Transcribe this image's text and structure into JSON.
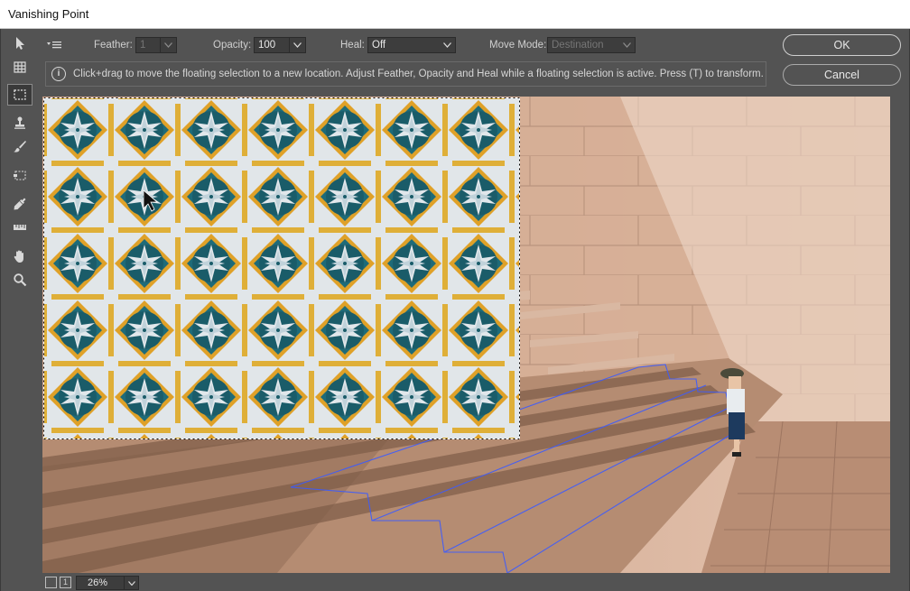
{
  "window": {
    "title": "Vanishing Point"
  },
  "toolbox": {
    "tools": [
      {
        "name": "edit-plane-tool",
        "icon": "arrow-pointer-icon"
      },
      {
        "name": "create-plane-tool",
        "icon": "grid-plane-icon"
      },
      {
        "name": "marquee-tool",
        "icon": "marquee-icon",
        "active": true
      },
      {
        "name": "stamp-tool",
        "icon": "stamp-icon"
      },
      {
        "name": "brush-tool",
        "icon": "brush-icon"
      },
      {
        "name": "transform-tool",
        "icon": "transform-icon"
      },
      {
        "name": "eyedropper-tool",
        "icon": "eyedropper-icon"
      },
      {
        "name": "measure-tool",
        "icon": "ruler-icon"
      },
      {
        "name": "hand-tool",
        "icon": "hand-icon"
      },
      {
        "name": "zoom-tool",
        "icon": "magnifier-icon"
      }
    ]
  },
  "options": {
    "feather_label": "Feather:",
    "feather_value": "1",
    "opacity_label": "Opacity:",
    "opacity_value": "100",
    "heal_label": "Heal:",
    "heal_value": "Off",
    "move_mode_label": "Move Mode:",
    "move_mode_value": "Destination"
  },
  "info": {
    "text": "Click+drag to move the floating selection to a new location. Adjust Feather, Opacity and Heal while a floating selection is active. Press (T) to transform."
  },
  "buttons": {
    "ok": "OK",
    "cancel": "Cancel"
  },
  "status": {
    "zoom": "26%"
  },
  "colors": {
    "panel": "#535353",
    "tile_teal": "#1e6f7e",
    "tile_yellow": "#e9a92c",
    "tile_white": "#e8edf0",
    "wall": "#d8b39b",
    "plane_lines": "#3b5bff"
  }
}
